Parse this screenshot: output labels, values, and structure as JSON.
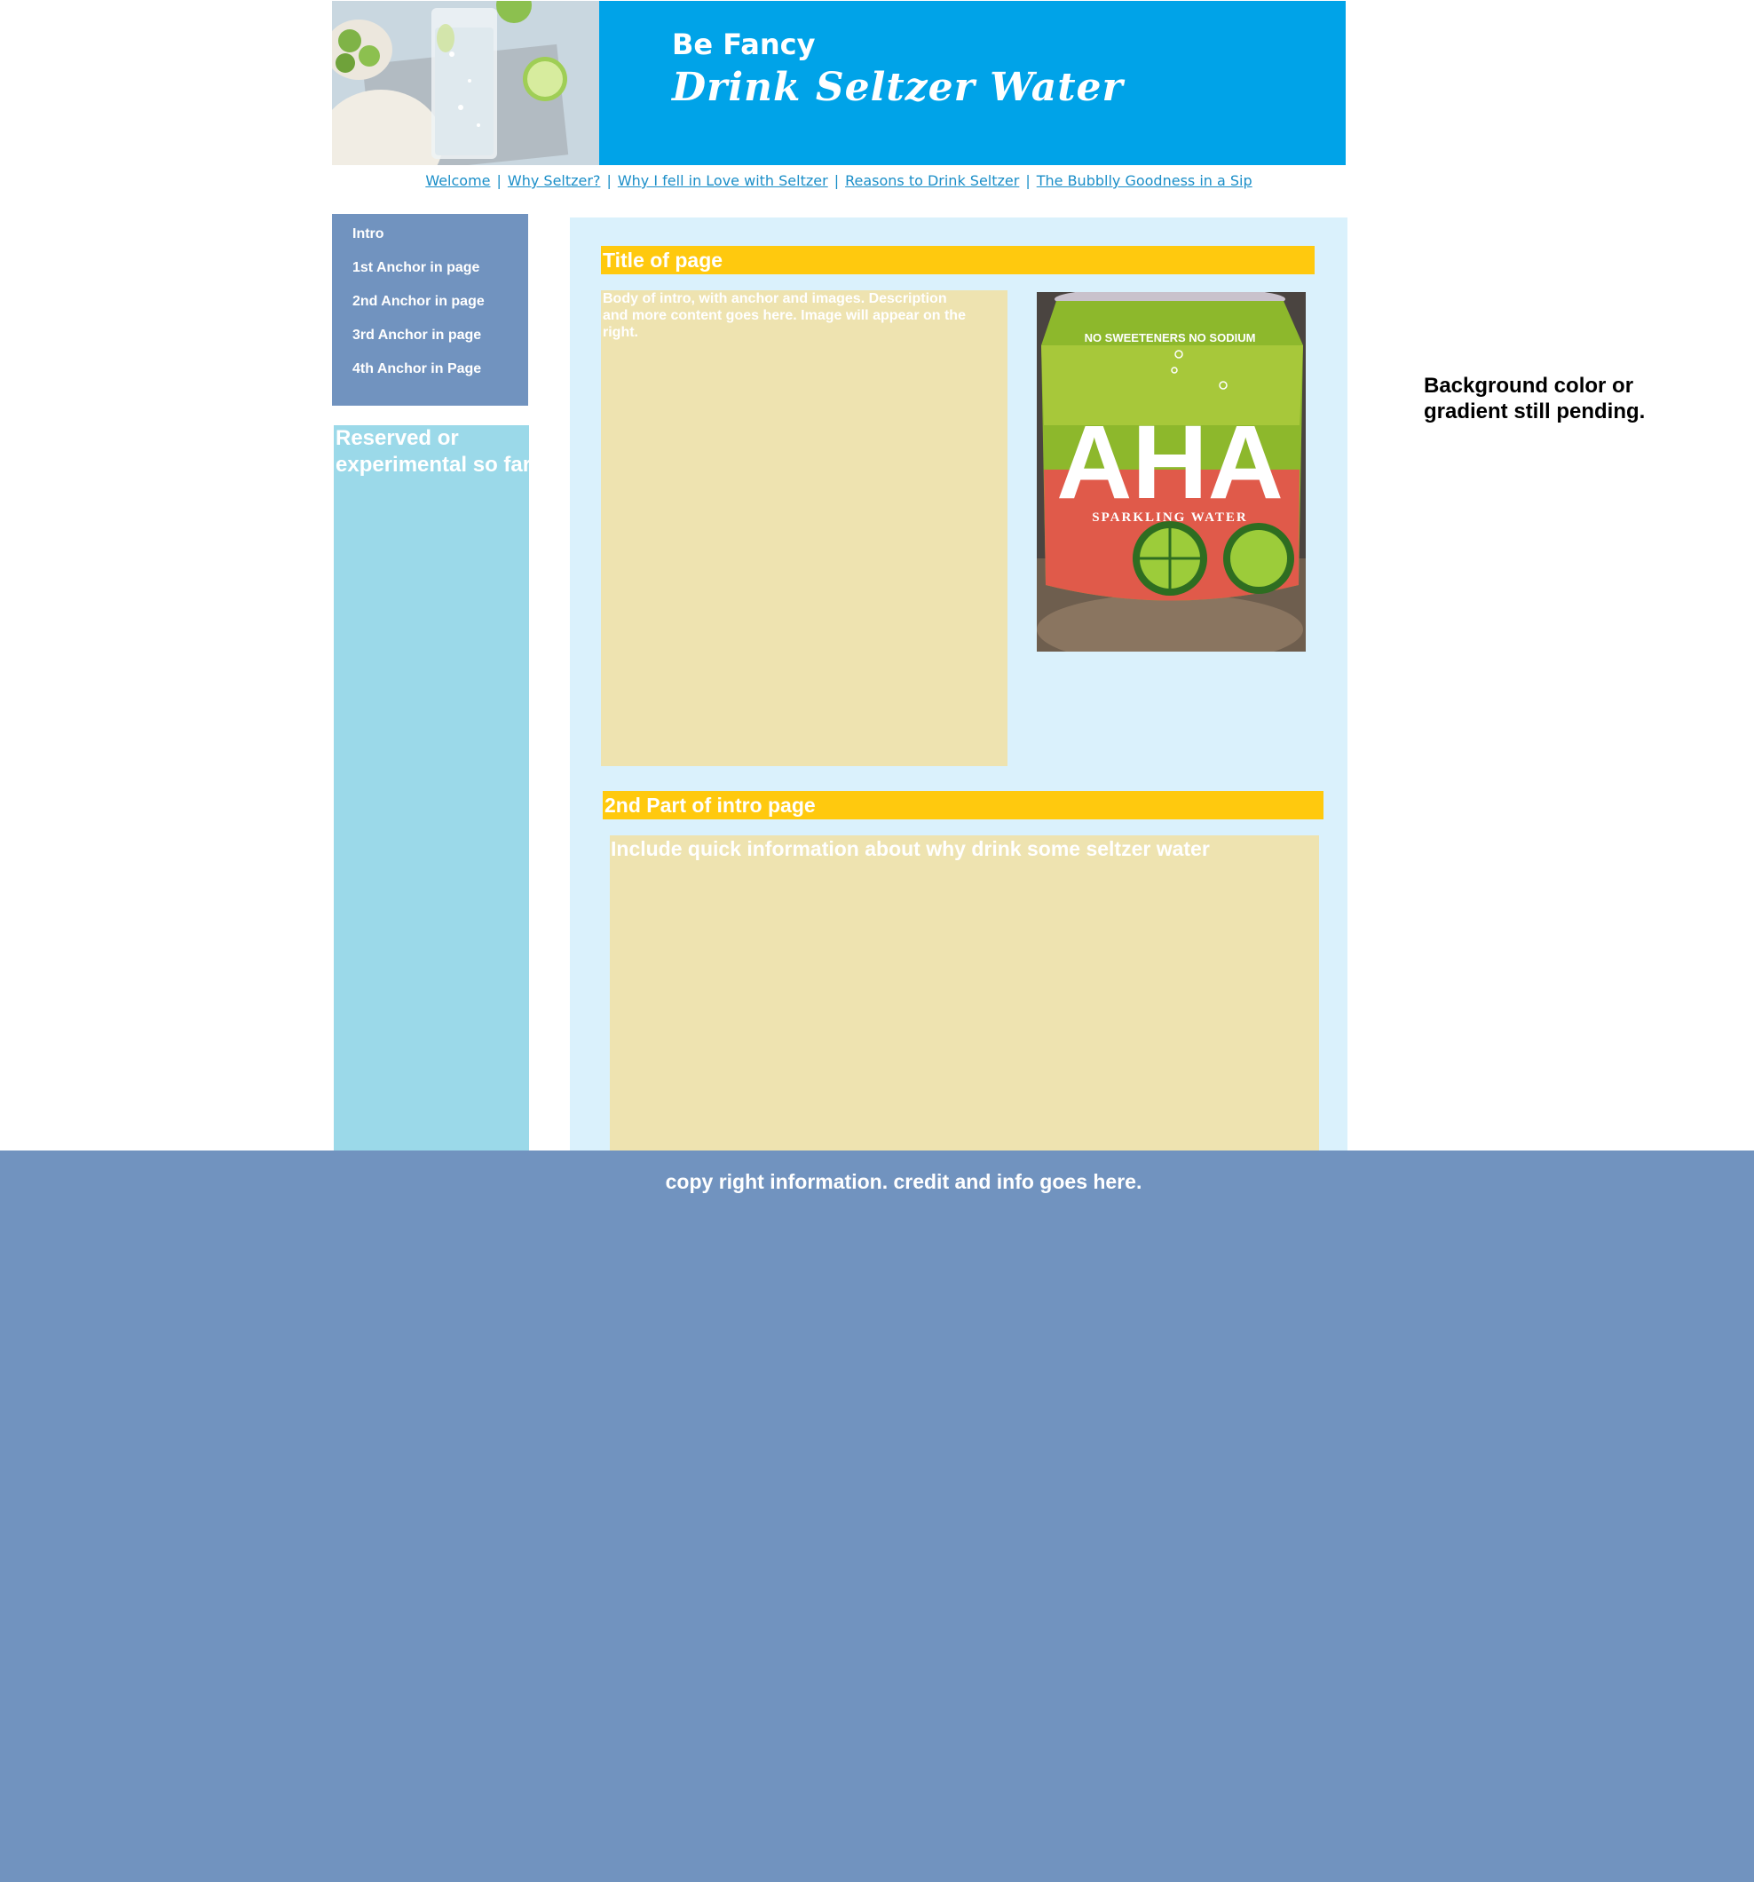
{
  "header": {
    "tagline": "Be Fancy",
    "title": "Drink Seltzer Water"
  },
  "nav": {
    "links": [
      "Welcome",
      "Why Seltzer?",
      "Why I fell in Love with Seltzer",
      "Reasons to Drink Seltzer",
      "The Bubblly Goodness in a Sip"
    ],
    "separator": "|"
  },
  "sidebar": {
    "items": [
      "Intro",
      "1st Anchor in page",
      "2nd Anchor in page",
      "3rd Anchor in page",
      "4th Anchor in Page"
    ],
    "reserved_text": "Reserved or experimental so far"
  },
  "main": {
    "section1": {
      "title": "Title of page",
      "body": "Body of intro, with anchor and images. Description and more content goes here. Image will appear on the right."
    },
    "image": {
      "can_top_text": "NO SWEETENERS  NO SODIUM",
      "can_brand": "AHA",
      "can_sub": "SPARKLING WATER"
    },
    "section2": {
      "title": "2nd Part of intro page",
      "body": "Include quick information about why drink some seltzer water"
    }
  },
  "footer": {
    "text": "copy right information. credit and info goes here."
  },
  "side_note": "Background color or gradient still pending.",
  "colors": {
    "banner": "#00a3e8",
    "menu": "#7193bf",
    "reserved": "#9bd9e9",
    "main_bg": "#daf1fc",
    "title_bar": "#ffc90e",
    "tan_box": "#eee3b0"
  }
}
